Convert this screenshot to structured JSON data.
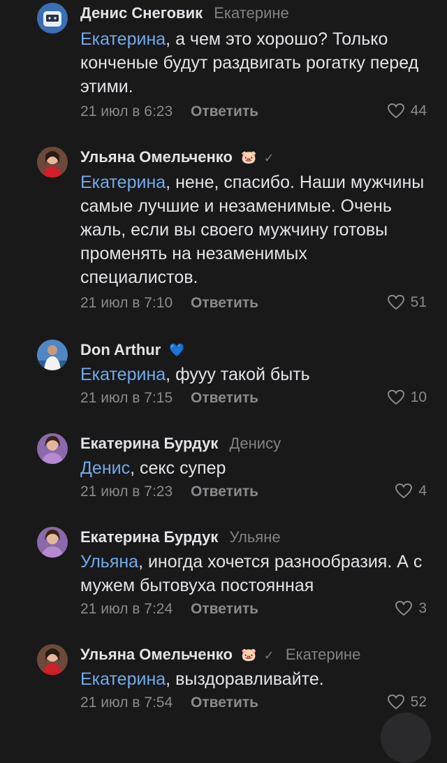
{
  "comments": [
    {
      "author": "Денис Снеговик",
      "reply_to": "Екатерине",
      "mention": "Екатерина",
      "text": ", а чем это хорошо? Только конченые будут раздвигать рогатку перед этими.",
      "time": "21 июл в 6:23",
      "reply_label": "Ответить",
      "likes": "44"
    },
    {
      "author": "Ульяна Омельченко",
      "badge": "🐷",
      "verified": "✓",
      "mention": "Екатерина",
      "text": ", нене, спасибо. Наши мужчины самые лучшие и незаменимые. Очень жаль, если вы своего мужчину готовы променять на незаменимых специалистов.",
      "time": "21 июл в 7:10",
      "reply_label": "Ответить",
      "likes": "51"
    },
    {
      "author": "Don Arthur",
      "badge": "💙",
      "mention": "Екатерина",
      "text": ", фууу такой быть",
      "time": "21 июл в 7:15",
      "reply_label": "Ответить",
      "likes": "10"
    },
    {
      "author": "Екатерина Бурдук",
      "reply_to": "Денису",
      "mention": "Денис",
      "text": ", секс супер",
      "time": "21 июл в 7:23",
      "reply_label": "Ответить",
      "likes": "4"
    },
    {
      "author": "Екатерина Бурдук",
      "reply_to": "Ульяне",
      "mention": "Ульяна",
      "text": ", иногда хочется разнообразия. А с мужем бытовуха постоянная",
      "time": "21 июл в 7:24",
      "reply_label": "Ответить",
      "likes": "3"
    },
    {
      "author": "Ульяна Омельченко",
      "badge": "🐷",
      "verified": "✓",
      "reply_to": "Екатерине",
      "mention": "Екатерина",
      "text": ", выздоравливайте.",
      "time": "21 июл в 7:54",
      "reply_label": "Ответить",
      "likes": "52"
    }
  ],
  "icons": {
    "like": "heart-outline-icon"
  },
  "colors": {
    "background": "#19191a",
    "mention": "#71aaeb",
    "muted": "#8a8a8e"
  }
}
